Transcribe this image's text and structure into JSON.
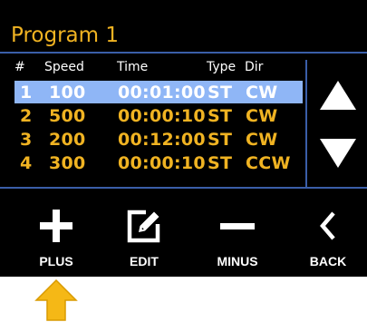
{
  "title": "Program 1",
  "table": {
    "headers": [
      "#",
      "Speed",
      "Time",
      "Type",
      "Dir"
    ],
    "rows": [
      {
        "num": "1",
        "speed": "100",
        "time": "00:01:00",
        "type": "ST",
        "dir": "CW",
        "selected": true
      },
      {
        "num": "2",
        "speed": "500",
        "time": "00:00:10",
        "type": "ST",
        "dir": "CW",
        "selected": false
      },
      {
        "num": "3",
        "speed": "200",
        "time": "00:12:00",
        "type": "ST",
        "dir": "CW",
        "selected": false
      },
      {
        "num": "4",
        "speed": "300",
        "time": "00:00:10",
        "type": "ST",
        "dir": "CCW",
        "selected": false
      }
    ]
  },
  "buttons": {
    "plus": "PLUS",
    "edit": "EDIT",
    "minus": "MINUS",
    "back": "BACK"
  },
  "icons": {
    "scroll_up": "triangle-up-icon",
    "scroll_down": "triangle-down-icon",
    "plus": "plus-icon",
    "edit": "edit-icon",
    "minus": "minus-icon",
    "back": "chevron-left-icon",
    "pointer": "arrow-up-icon"
  },
  "colors": {
    "background": "#000000",
    "accent": "#f0b322",
    "selection": "#8fb6f6",
    "separator": "#3a5ea8"
  }
}
